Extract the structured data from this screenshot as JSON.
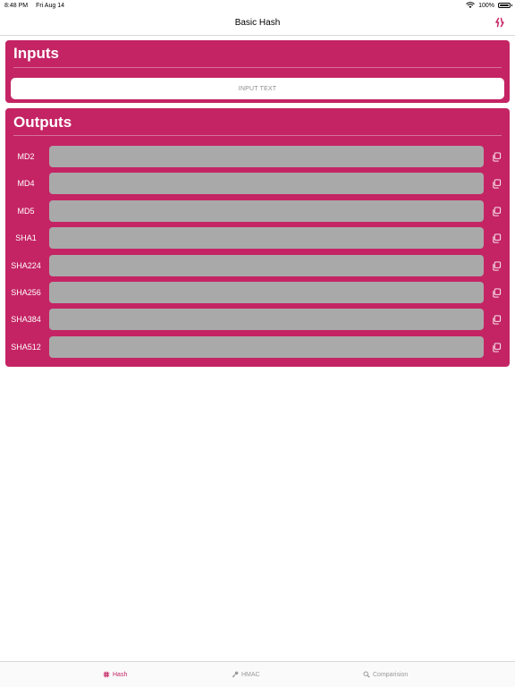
{
  "status_bar": {
    "time": "8:48 PM",
    "date": "Fri Aug 14",
    "battery": "100%"
  },
  "nav": {
    "title": "Basic Hash",
    "action_icon": "swap-arrows-icon"
  },
  "inputs": {
    "title": "Inputs",
    "placeholder": "INPUT TEXT",
    "value": ""
  },
  "outputs": {
    "title": "Outputs",
    "rows": [
      {
        "label": "MD2",
        "value": ""
      },
      {
        "label": "MD4",
        "value": ""
      },
      {
        "label": "MD5",
        "value": ""
      },
      {
        "label": "SHA1",
        "value": ""
      },
      {
        "label": "SHA224",
        "value": ""
      },
      {
        "label": "SHA256",
        "value": ""
      },
      {
        "label": "SHA384",
        "value": ""
      },
      {
        "label": "SHA512",
        "value": ""
      }
    ]
  },
  "tabs": [
    {
      "label": "Hash",
      "icon": "hash-icon",
      "active": true
    },
    {
      "label": "HMAC",
      "icon": "key-icon",
      "active": false
    },
    {
      "label": "Comparision",
      "icon": "magnifier-icon",
      "active": false
    }
  ],
  "colors": {
    "accent": "#c42464",
    "output_field": "#a9a9a9",
    "inactive_tab": "#999999"
  }
}
